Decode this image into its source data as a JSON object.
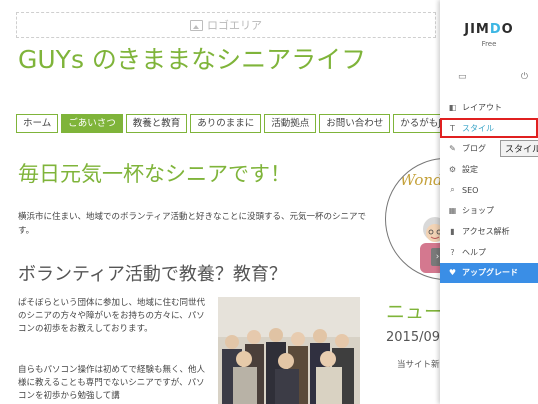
{
  "logo_area": {
    "label": "ロゴエリア"
  },
  "site": {
    "title": "GUYs のきままなシニアライフ"
  },
  "nav": [
    {
      "label": "ホーム"
    },
    {
      "label": "ごあいさつ",
      "active": true
    },
    {
      "label": "教養と教育"
    },
    {
      "label": "ありのままに"
    },
    {
      "label": "活動拠点"
    },
    {
      "label": "お問い合わせ"
    },
    {
      "label": "かるがもJim"
    }
  ],
  "main": {
    "heading": "毎日元気一杯なシニアです！",
    "intro": "横浜市に住まい、地域でのボランティア活動と好きなことに没頭する、元気一杯のシニアです。",
    "subheading": "ボランティア活動で教養？教育？",
    "body1": "ぱそぼらという団体に参加し、地域に住む同世代のシニアの方々や障がいをお持ちの方々に、パソコンの初歩をお教えしております。",
    "body2": "自らもパソコン操作は初めてで経験も無く、他人様に教えることも専門でないシニアですが、パソコンを初歩から勉強して講"
  },
  "sidebar_image": {
    "text": "Wond"
  },
  "news": {
    "title": "ニュー",
    "date": "2015/09/",
    "text": "当サイト新"
  },
  "panel": {
    "brand_prefix": "JIM",
    "brand_o": "D",
    "brand_suffix": "O",
    "plan": "Free",
    "menu": [
      {
        "label": "レイアウト",
        "icon": "layout-icon"
      },
      {
        "label": "スタイル",
        "icon": "style-icon",
        "selected": true
      },
      {
        "label": "ブログ",
        "icon": "blog-icon"
      },
      {
        "label": "設定",
        "icon": "settings-icon"
      },
      {
        "label": "SEO",
        "icon": "seo-icon"
      },
      {
        "label": "ショップ",
        "icon": "shop-icon"
      },
      {
        "label": "アクセス解析",
        "icon": "analytics-icon"
      },
      {
        "label": "ヘルプ",
        "icon": "help-icon"
      },
      {
        "label": "アップグレード",
        "icon": "heart-icon",
        "upgrade": true
      }
    ],
    "tooltip": "スタイル"
  },
  "colors": {
    "accent": "#7fb43a",
    "upgrade": "#3a8ee6",
    "highlight": "#e02020"
  }
}
